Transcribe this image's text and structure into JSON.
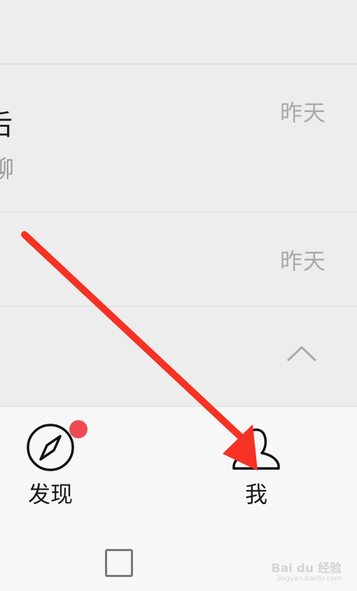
{
  "chat_list": {
    "items": [
      {
        "title": "后",
        "subtitle": "聊",
        "time": "昨天"
      },
      {
        "time": "昨天"
      }
    ],
    "collapse_icon": "chevron-up-icon"
  },
  "tab_bar": {
    "discover": {
      "label": "发现",
      "icon": "compass-icon",
      "badge_color": "#ef4a52"
    },
    "me": {
      "label": "我",
      "icon": "person-icon"
    }
  },
  "nav_bar": {
    "icon": "recent-apps-icon"
  },
  "annotation": {
    "color": "#f53223",
    "icon": "red-arrow"
  },
  "watermark": {
    "text": "Bai du 经验",
    "sub": "jingyan.baidu.com"
  }
}
